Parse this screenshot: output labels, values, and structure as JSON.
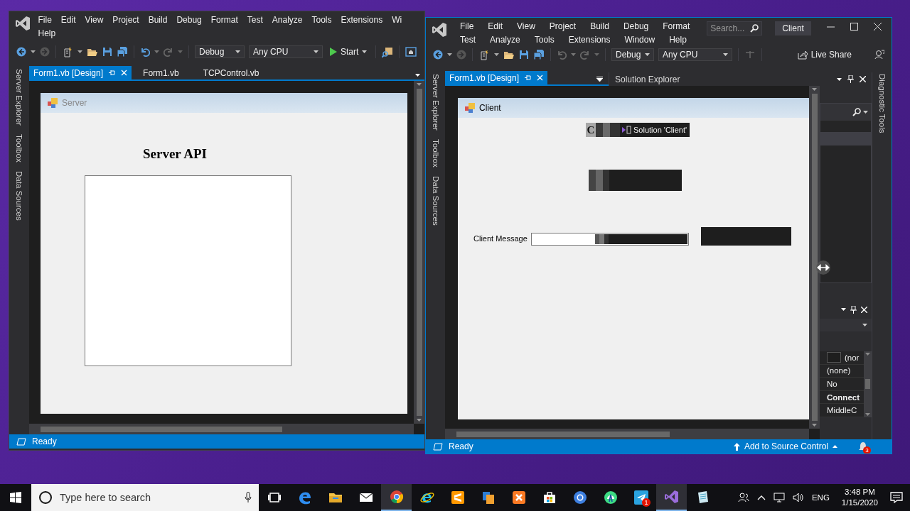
{
  "server_window": {
    "menu_rows": [
      [
        "File",
        "Edit",
        "View",
        "Project",
        "Build",
        "Debug",
        "Format",
        "Test",
        "Analyze",
        "Tools",
        "Extensions",
        "Wi"
      ],
      [
        "Help"
      ]
    ],
    "toolbar": {
      "configuration": "Debug",
      "platform": "Any CPU",
      "start": "Start"
    },
    "tabs": [
      {
        "label": "Form1.vb [Design]",
        "selected": true
      },
      {
        "label": "Form1.vb",
        "selected": false
      },
      {
        "label": "TCPControl.vb",
        "selected": false
      }
    ],
    "side_tabs": [
      "Server Explorer",
      "Toolbox",
      "Data Sources"
    ],
    "form": {
      "title": "Server",
      "heading": "Server API"
    },
    "status": "Ready"
  },
  "client_window": {
    "menu_rows": [
      [
        "File",
        "Edit",
        "View",
        "Project",
        "Build",
        "Debug",
        "Format"
      ],
      [
        "Test",
        "Analyze",
        "Tools",
        "Extensions",
        "Window",
        "Help"
      ]
    ],
    "search": {
      "placeholder": "Search..."
    },
    "title": "Client",
    "toolbar": {
      "configuration": "Debug",
      "platform": "Any CPU",
      "live_share": "Live Share"
    },
    "tabs": [
      {
        "label": "Form1.vb [Design]",
        "selected": true
      }
    ],
    "side_tabs": [
      "Server Explorer",
      "Toolbox",
      "Data Sources"
    ],
    "right_side_tabs": [
      "Diagnostic Tools"
    ],
    "solution_explorer": {
      "title": "Solution Explorer"
    },
    "form": {
      "title": "Client",
      "overlay_letter": "C",
      "overlay_text": "Solution 'Client'",
      "message_label": "Client Message"
    },
    "properties": [
      {
        "value": "(nor",
        "kind": "color",
        "modified": false
      },
      {
        "value": "(none)",
        "kind": "text",
        "modified": false
      },
      {
        "value": "No",
        "kind": "text",
        "modified": false
      },
      {
        "value": "Connect",
        "kind": "text",
        "modified": true
      },
      {
        "value": "MiddleC",
        "kind": "text",
        "modified": false
      }
    ],
    "status": "Ready",
    "source_control": "Add to Source Control",
    "notifications": "3"
  },
  "taskbar": {
    "search_placeholder": "Type here to search",
    "apps": [
      {
        "kind": "taskview",
        "active": false
      },
      {
        "kind": "edge",
        "active": false
      },
      {
        "kind": "folder",
        "active": false
      },
      {
        "kind": "mail",
        "active": false
      },
      {
        "kind": "chrome",
        "active": true
      },
      {
        "kind": "ie",
        "active": false
      },
      {
        "kind": "sublime",
        "active": false
      },
      {
        "kind": "office",
        "active": false
      },
      {
        "kind": "xampp",
        "active": false
      },
      {
        "kind": "store",
        "active": false
      },
      {
        "kind": "canary",
        "active": false
      },
      {
        "kind": "android",
        "active": false
      },
      {
        "kind": "telegram",
        "active": false,
        "badge": "1"
      },
      {
        "kind": "vs",
        "active": true
      },
      {
        "kind": "notepad",
        "active": false
      }
    ],
    "language": "ENG",
    "time": "3:48 PM",
    "date": "1/15/2020"
  }
}
